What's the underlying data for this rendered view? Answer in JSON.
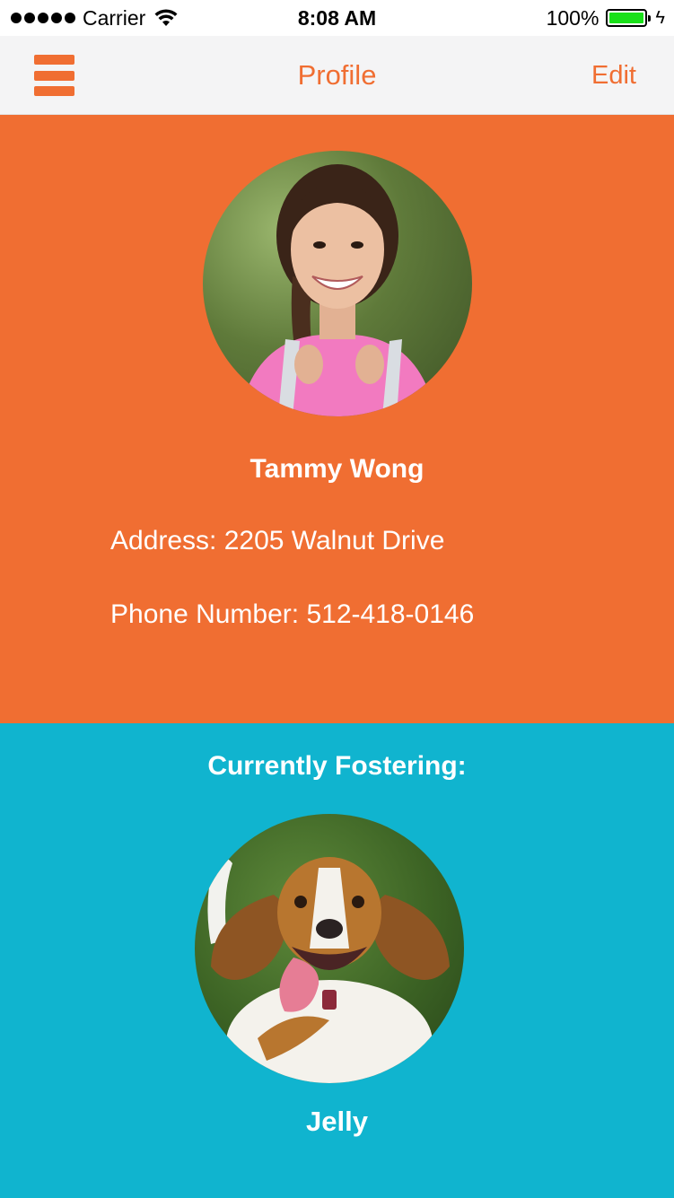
{
  "status_bar": {
    "carrier": "Carrier",
    "time": "8:08 AM",
    "battery": "100%",
    "battery_level": 1.0
  },
  "nav": {
    "title": "Profile",
    "edit_label": "Edit",
    "menu_icon": "hamburger-menu-icon"
  },
  "profile": {
    "name": "Tammy Wong",
    "address": "Address: 2205 Walnut Drive",
    "phone": "Phone Number: 512-418-0146"
  },
  "fostering": {
    "heading": "Currently Fostering:",
    "pet_name": "Jelly"
  },
  "colors": {
    "accent_orange": "#f06e32",
    "accent_teal": "#10b4cf",
    "nav_background": "#f4f4f5",
    "battery_green": "#19e019"
  }
}
